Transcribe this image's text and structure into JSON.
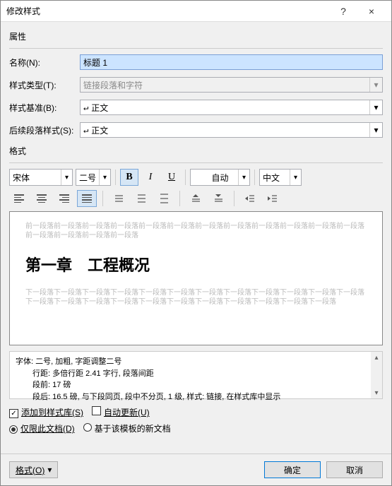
{
  "titlebar": {
    "title": "修改样式",
    "help": "?",
    "close": "×"
  },
  "sections": {
    "properties": "属性",
    "format": "格式"
  },
  "labels": {
    "name": "名称(N):",
    "style_type": "样式类型(T):",
    "based_on": "样式基准(B):",
    "following": "后续段落样式(S):"
  },
  "fields": {
    "name_value": "标题 1",
    "style_type_value": "链接段落和字符",
    "based_on_value": "正文",
    "following_value": "正文"
  },
  "format_bar": {
    "font_name": "宋体",
    "font_size": "二号",
    "auto_color": "自动",
    "language": "中文",
    "B": "B",
    "I": "I",
    "U": "U"
  },
  "preview": {
    "gray_before": "前一段落前一段落前一段落前一段落前一段落前一段落前一段落前一段落前一段落前一段落前一段落前一段落前一段落前一段落前一段落前一段落",
    "heading": "第一章　工程概况",
    "gray_after": "下一段落下一段落下一段落下一段落下一段落下一段落下一段落下一段落下一段落下一段落下一段落下一段落下一段落下一段落下一段落下一段落下一段落下一段落下一段落下一段落下一段落下一段落下一段落"
  },
  "description": {
    "l1": "字体: 二号, 加粗, 字距调整二号",
    "l2": "行距: 多倍行距 2.41 字行, 段落间距",
    "l3": "段前: 17 磅",
    "l4": "段后: 16.5 磅, 与下段同页, 段中不分页, 1 级, 样式: 链接, 在样式库中显示"
  },
  "options": {
    "add_to_gallery": "添加到样式库(S)",
    "auto_update": "自动更新(U)",
    "this_doc": "仅限此文档(D)",
    "template": "基于该模板的新文档"
  },
  "footer": {
    "format_menu": "格式(O)",
    "ok": "确定",
    "cancel": "取消"
  },
  "glyphs": {
    "down": "▾",
    "ret": "↵",
    "check": "✓",
    "up": "▴"
  }
}
